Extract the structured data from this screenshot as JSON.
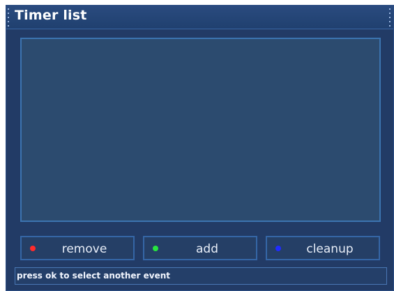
{
  "window": {
    "title": "Timer list"
  },
  "buttons": {
    "remove": {
      "label": "remove",
      "color_dot": "#ff2b2b"
    },
    "add": {
      "label": "add",
      "color_dot": "#27e53f"
    },
    "cleanup": {
      "label": "cleanup",
      "color_dot": "#1f2cff"
    }
  },
  "status": {
    "message": "press ok to select another event"
  },
  "colors": {
    "window_bg": "#223b66",
    "list_bg": "#2c4b6f",
    "accent_border": "#3c74b0"
  }
}
